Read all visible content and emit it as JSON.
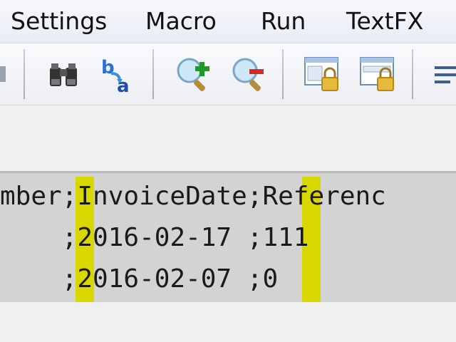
{
  "menu": {
    "items": [
      {
        "label": "Settings"
      },
      {
        "label": "Macro"
      },
      {
        "label": "Run"
      },
      {
        "label": "TextFX"
      }
    ]
  },
  "toolbar": {
    "icons": [
      "find-binoculars-icon",
      "replace-icon",
      "zoom-in-icon",
      "zoom-out-icon",
      "lock-window-icon",
      "lock-window-2-icon",
      "word-wrap-icon"
    ]
  },
  "editor": {
    "lines": [
      "mber;InvoiceDate;Referenc",
      "    ;2016-02-17 ;111",
      "    ;2016-02-07 ;0"
    ],
    "separator_highlight": "#d8d800",
    "background": "#d3d3d3"
  }
}
